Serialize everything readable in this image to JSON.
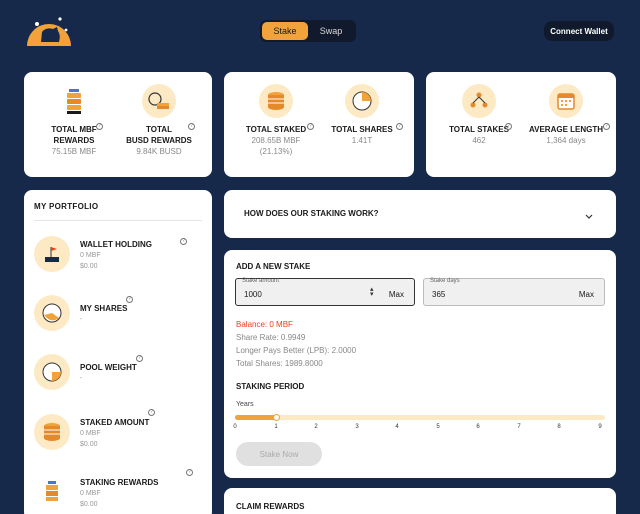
{
  "header": {
    "tabs": [
      {
        "label": "Stake",
        "active": true
      },
      {
        "label": "Swap",
        "active": false
      }
    ],
    "connect_label": "Connect Wallet"
  },
  "stats": {
    "total_mbf_rewards": {
      "label1": "TOTAL MBF",
      "label2": "REWARDS",
      "value": "75.15B MBF"
    },
    "total_busd_rewards": {
      "label1": "TOTAL",
      "label2": "BUSD REWARDS",
      "value": "9.84K BUSD"
    },
    "total_staked": {
      "label": "TOTAL STAKED",
      "value": "208.65B MBF",
      "value2": "(21.13%)"
    },
    "total_shares": {
      "label": "TOTAL SHARES",
      "value": "1.41T"
    },
    "total_stakes": {
      "label": "TOTAL STAKES",
      "value": "462"
    },
    "average_length": {
      "label": "AVERAGE LENGTH",
      "value": "1,364 days"
    }
  },
  "portfolio": {
    "title": "MY PORTFOLIO",
    "items": [
      {
        "label": "WALLET HOLDING",
        "values": [
          "0 MBF",
          "$0.00"
        ],
        "icon": "flag-icon"
      },
      {
        "label": "MY SHARES",
        "values": [
          "-"
        ],
        "icon": "pie-icon"
      },
      {
        "label": "POOL WEIGHT",
        "values": [
          "-"
        ],
        "icon": "pie-chart-icon"
      },
      {
        "label": "STAKED AMOUNT",
        "values": [
          "0 MBF",
          "$0.00"
        ],
        "icon": "coin-stack-icon"
      },
      {
        "label": "STAKING REWARDS",
        "values": [
          "0 MBF",
          "$0.00"
        ],
        "icon": "coin-stack-small-icon"
      }
    ]
  },
  "faq": {
    "title": "HOW DOES OUR STAKING WORK?"
  },
  "new_stake": {
    "title": "ADD A NEW STAKE",
    "amount_label": "Stake amount",
    "amount_value": "1000",
    "amount_max": "Max",
    "days_label": "Stake days",
    "days_value": "365",
    "days_max": "Max",
    "balance": "Balance: 0 MBF",
    "share_rate": "Share Rate: 0.9949",
    "lpb": "Longer Pays Better (LPB): 2.0000",
    "total_shares": "Total Shares: 1989.8000",
    "period_title": "STAKING PERIOD",
    "years_label": "Years",
    "slider_value_years": 1,
    "slider_max_years": 9,
    "ticks": [
      "0",
      "1",
      "2",
      "3",
      "4",
      "5",
      "6",
      "7",
      "8",
      "9"
    ],
    "stake_button": "Stake Now"
  },
  "claim": {
    "title": "CLAIM REWARDS"
  },
  "colors": {
    "bg": "#16294a",
    "accent": "#f2a23a",
    "icon_bg": "#fde9c4",
    "error": "#e8421d"
  }
}
